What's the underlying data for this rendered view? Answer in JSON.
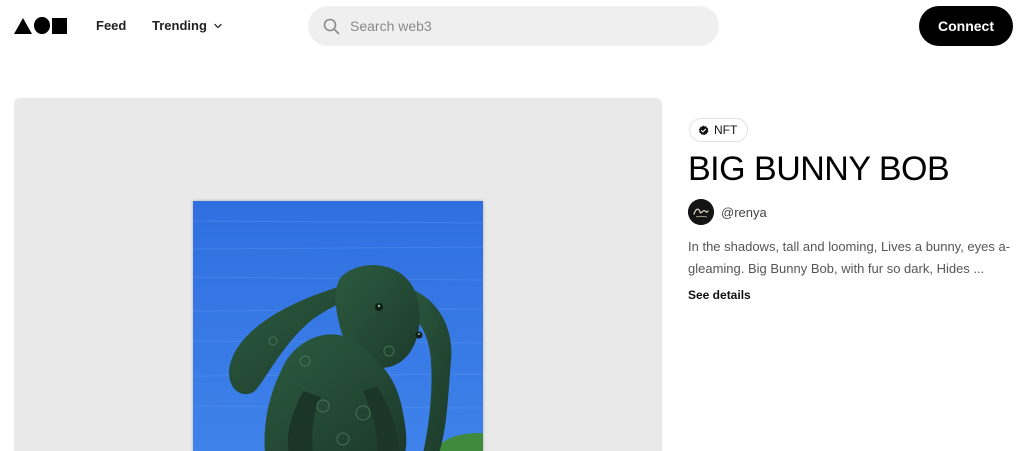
{
  "header": {
    "nav": {
      "feed_label": "Feed",
      "trending_label": "Trending"
    },
    "search": {
      "placeholder": "Search web3"
    },
    "connect_label": "Connect"
  },
  "icons": {
    "logo": "triangle-circle-square-logo",
    "trending_chevron": "chevron-down-icon",
    "search": "search-icon",
    "badge": "verified-check-icon"
  },
  "colors": {
    "accent": "#000000",
    "search_bg": "#efefef",
    "media_bg": "#e9e9e9",
    "artwork_sky": "#3a76e0",
    "artwork_bunny": "#244a35"
  },
  "item": {
    "badge_label": "NFT",
    "title": "BIG BUNNY BOB",
    "creator": "@renya",
    "description": "In the shadows, tall and looming, Lives a bunny, eyes a-gleaming. Big Bunny Bob, with fur so dark, Hides ...",
    "see_details_label": "See details"
  }
}
